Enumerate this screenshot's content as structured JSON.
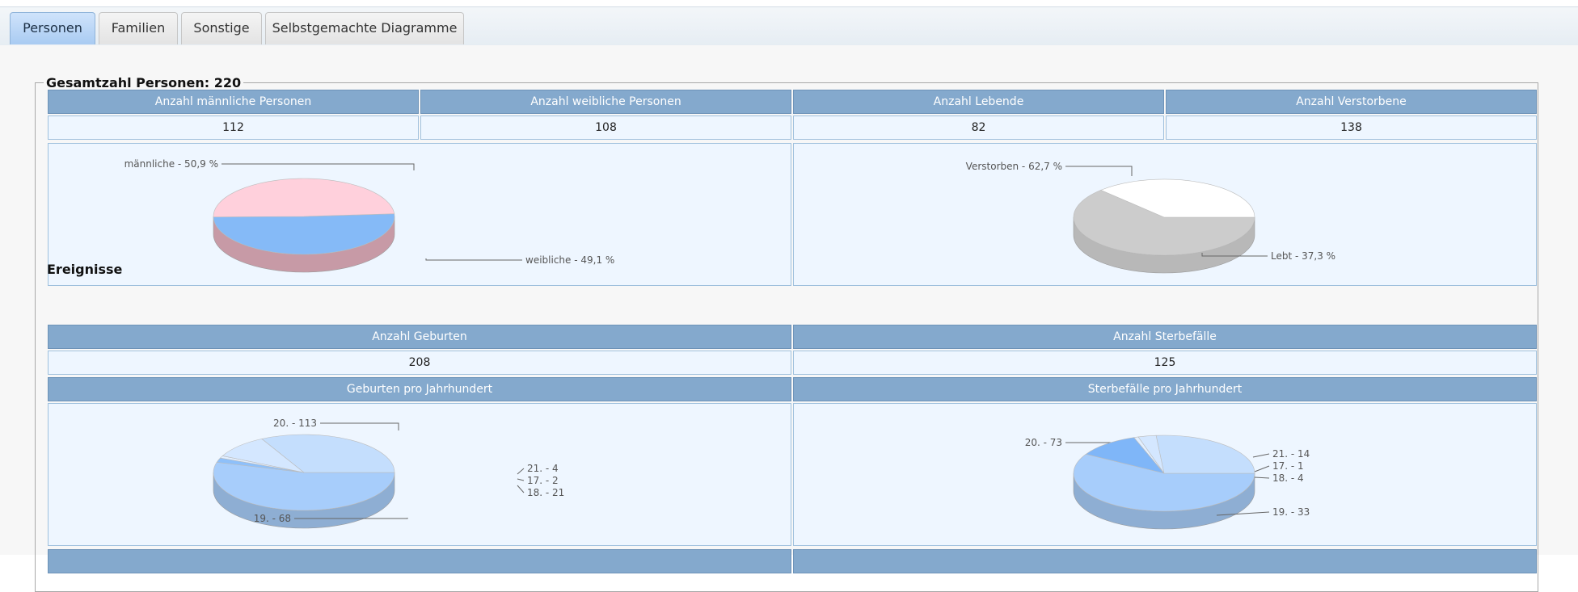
{
  "tabs": [
    {
      "label": "Personen",
      "active": true
    },
    {
      "label": "Familien",
      "active": false
    },
    {
      "label": "Sonstige",
      "active": false
    },
    {
      "label": "Selbstgemachte Diagramme",
      "active": false
    }
  ],
  "summary": {
    "legend": "Gesamtzahl Personen: 220",
    "headers": [
      "Anzahl männliche Personen",
      "Anzahl weibliche Personen",
      "Anzahl Lebende",
      "Anzahl Verstorbene"
    ],
    "values": [
      "112",
      "108",
      "82",
      "138"
    ]
  },
  "events": {
    "title": "Ereignisse",
    "headers": [
      "Anzahl Geburten",
      "Anzahl Sterbefälle"
    ],
    "values": [
      "208",
      "125"
    ],
    "chart_headers": [
      "Geburten pro Jahrhundert",
      "Sterbefälle pro Jahrhundert"
    ]
  },
  "colors": {
    "header_bg": "#84a9cd",
    "cell_bg": "#eef6ff",
    "male": "#85baf7",
    "female": "#ffd0dc",
    "deceased": "#cccccc",
    "living": "#ffffff"
  },
  "chart_data": [
    {
      "type": "pie",
      "slices": [
        {
          "label": "männliche - 50,9 %",
          "value": 50.9,
          "color": "#85baf7"
        },
        {
          "label": "weibliche - 49,1 %",
          "value": 49.1,
          "color": "#ffd0dc"
        }
      ]
    },
    {
      "type": "pie",
      "slices": [
        {
          "label": "Verstorben - 62,7 %",
          "value": 62.7,
          "color": "#cccccc"
        },
        {
          "label": "Lebt - 37,3 %",
          "value": 37.3,
          "color": "#ffffff"
        }
      ]
    },
    {
      "type": "pie",
      "slices": [
        {
          "label": "20. - 113",
          "value": 113,
          "color": "#a7cdfb"
        },
        {
          "label": "21. - 4",
          "value": 4,
          "color": "#8ec0fa"
        },
        {
          "label": "17. - 2",
          "value": 2,
          "color": "#e2efff"
        },
        {
          "label": "18. - 21",
          "value": 21,
          "color": "#d4e7ff"
        },
        {
          "label": "19. - 68",
          "value": 68,
          "color": "#c4defd"
        }
      ]
    },
    {
      "type": "pie",
      "slices": [
        {
          "label": "20. - 73",
          "value": 73,
          "color": "#a7cdfb"
        },
        {
          "label": "21. - 14",
          "value": 14,
          "color": "#7fb6f8"
        },
        {
          "label": "17. - 1",
          "value": 1,
          "color": "#e2efff"
        },
        {
          "label": "18. - 4",
          "value": 4,
          "color": "#d4e7ff"
        },
        {
          "label": "19. - 33",
          "value": 33,
          "color": "#c4defd"
        }
      ]
    }
  ]
}
